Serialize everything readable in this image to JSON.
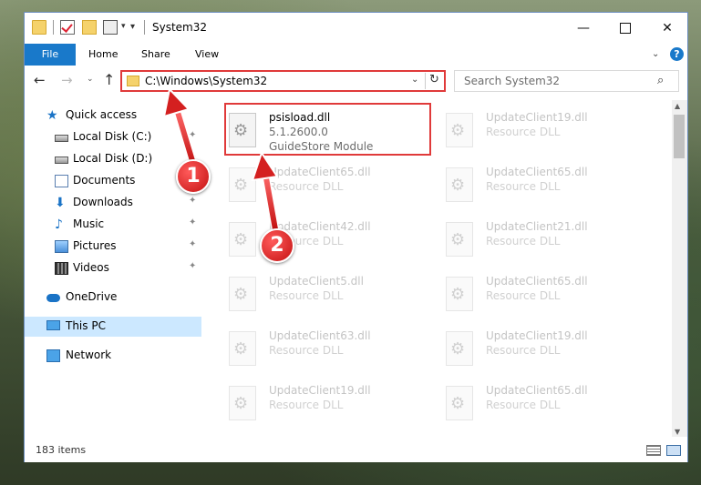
{
  "window": {
    "title": "System32",
    "controls": {
      "minimize": "—",
      "close": "✕"
    }
  },
  "ribbon": {
    "tabs": [
      "File",
      "Home",
      "Share",
      "View"
    ],
    "expand": "⌄",
    "help": "?"
  },
  "navbar": {
    "back": "←",
    "forward": "→",
    "recent": "⌄",
    "up": "↑",
    "address": "C:\\Windows\\System32",
    "dropdown": "⌄",
    "refresh": "↻",
    "search_placeholder": "Search System32",
    "search_icon": "⌕"
  },
  "sidebar": {
    "items": [
      {
        "label": "Quick access",
        "icon": "star-icon",
        "glyph": "★",
        "pinned": false
      },
      {
        "label": "Local Disk (C:)",
        "icon": "drive-icon",
        "pinned": true
      },
      {
        "label": "Local Disk (D:)",
        "icon": "drive-icon",
        "pinned": true
      },
      {
        "label": "Documents",
        "icon": "documents-icon",
        "pinned": true
      },
      {
        "label": "Downloads",
        "icon": "downloads-icon",
        "glyph": "⬇",
        "pinned": true
      },
      {
        "label": "Music",
        "icon": "music-icon",
        "glyph": "♪",
        "pinned": true
      },
      {
        "label": "Pictures",
        "icon": "pictures-icon",
        "pinned": true
      },
      {
        "label": "Videos",
        "icon": "videos-icon",
        "pinned": true
      },
      {
        "label": "OneDrive",
        "icon": "cloud-icon",
        "pinned": false
      },
      {
        "label": "This PC",
        "icon": "computer-icon",
        "pinned": false,
        "selected": true
      },
      {
        "label": "Network",
        "icon": "network-icon",
        "pinned": false
      }
    ],
    "pin_glyph": "📌"
  },
  "files": [
    {
      "name": "psisload.dll",
      "version": "5.1.2600.0",
      "description": "GuideStore Module",
      "highlighted": true
    },
    {
      "name": "UpdateClient19.dll",
      "description": "Resource DLL"
    },
    {
      "name": "UpdateClient65.dll",
      "description": "Resource DLL"
    },
    {
      "name": "UpdateClient65.dll",
      "description": "Resource DLL"
    },
    {
      "name": "UpdateClient42.dll",
      "description": "Resource DLL"
    },
    {
      "name": "UpdateClient21.dll",
      "description": "Resource DLL"
    },
    {
      "name": "UpdateClient5.dll",
      "description": "Resource DLL"
    },
    {
      "name": "UpdateClient65.dll",
      "description": "Resource DLL"
    },
    {
      "name": "UpdateClient63.dll",
      "description": "Resource DLL"
    },
    {
      "name": "UpdateClient19.dll",
      "description": "Resource DLL"
    },
    {
      "name": "UpdateClient19.dll",
      "description": "Resource DLL"
    },
    {
      "name": "UpdateClient65.dll",
      "description": "Resource DLL"
    }
  ],
  "status": {
    "item_count": "183 items"
  },
  "annotations": {
    "badge1": "1",
    "badge2": "2",
    "color": "#e03a3a"
  },
  "scrollbar": {
    "up": "▲",
    "down": "▼"
  },
  "colors": {
    "accent": "#1979ca",
    "highlight": "#e03a3a",
    "selected": "#cce8ff"
  }
}
